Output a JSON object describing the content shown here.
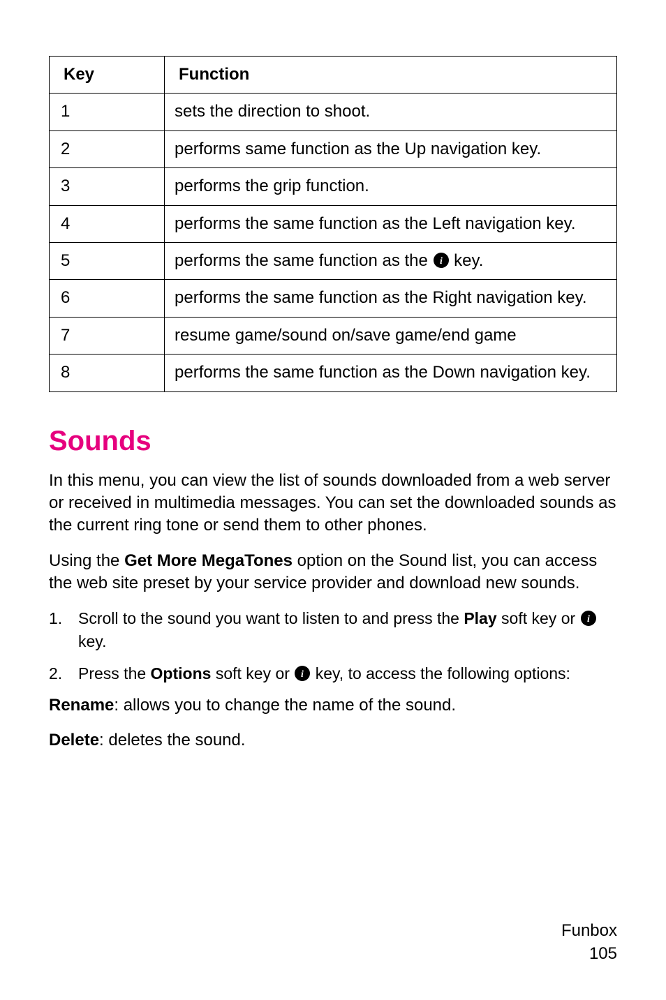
{
  "table": {
    "headers": {
      "key": "Key",
      "function": "Function"
    },
    "rows": [
      {
        "key": "1",
        "fn_a": "sets the direction to shoot."
      },
      {
        "key": "2",
        "fn_a": "performs same function as the Up navigation key."
      },
      {
        "key": "3",
        "fn_a": "performs the grip function."
      },
      {
        "key": "4",
        "fn_a": "performs the same function as the Left navigation key."
      },
      {
        "key": "5",
        "fn_a": "performs the same function as the ",
        "has_icon": true,
        "fn_b": " key."
      },
      {
        "key": "6",
        "fn_a": "performs the same function as the Right navigation key."
      },
      {
        "key": "7",
        "fn_a": "resume game/sound on/save game/end game"
      },
      {
        "key": "8",
        "fn_a": "performs the same function as the Down navigation key."
      }
    ]
  },
  "heading": "Sounds",
  "para1": "In this menu, you can view the list of sounds downloaded from a web server or received in multimedia messages. You can set the downloaded sounds as the current ring tone or send them to other phones.",
  "para2": {
    "a": "Using the ",
    "b": "Get More MegaTones",
    "c": " option on the Sound list, you can access the web site preset by your service provider and download new sounds."
  },
  "list": {
    "item1": {
      "num": "1.",
      "a": "Scroll to the sound you want to listen to and press the ",
      "b": "Play",
      "c": " soft key or ",
      "d": " key."
    },
    "item2": {
      "num": "2.",
      "a": "Press the ",
      "b": "Options",
      "c": " soft key or ",
      "d": " key, to access the following options:"
    }
  },
  "para3": {
    "a": "Rename",
    "b": ": allows you to change the name of the sound."
  },
  "para4": {
    "a": "Delete",
    "b": ": deletes the sound."
  },
  "footer": {
    "a": "Funbox",
    "b": "105"
  }
}
